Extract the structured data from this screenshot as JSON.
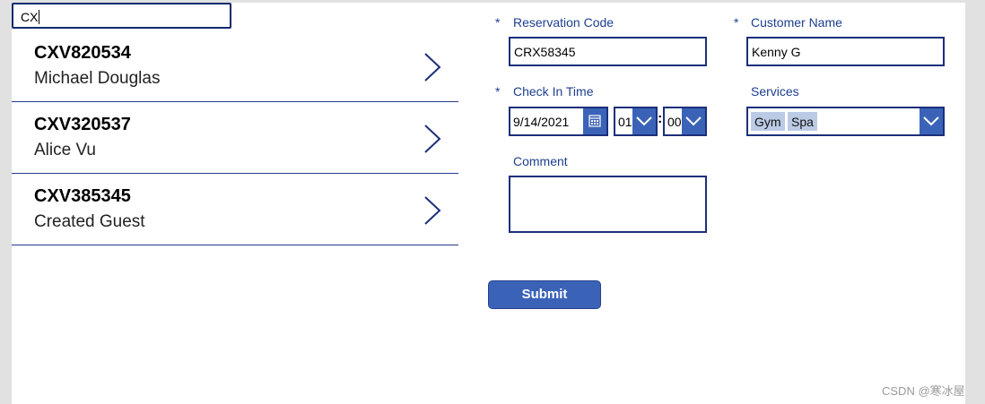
{
  "search": {
    "value": "CX"
  },
  "gallery": {
    "items": [
      {
        "code": "CXV820534",
        "name": "Michael Douglas"
      },
      {
        "code": "CXV320537",
        "name": "Alice Vu"
      },
      {
        "code": "CXV385345",
        "name": "Created Guest"
      }
    ]
  },
  "form": {
    "required_marker": "*",
    "reservation_code": {
      "label": "Reservation Code",
      "value": "CRX58345"
    },
    "customer_name": {
      "label": "Customer Name",
      "value": "Kenny G"
    },
    "check_in_time": {
      "label": "Check In Time",
      "date": "9/14/2021",
      "hour": "01",
      "minute": "00",
      "separator": ":"
    },
    "services": {
      "label": "Services",
      "selected": [
        "Gym",
        "Spa"
      ]
    },
    "comment": {
      "label": "Comment",
      "value": ""
    },
    "submit_label": "Submit"
  },
  "watermark": "CSDN @寒冰屋",
  "icons": {
    "gallery_chevron": "chevron-right-icon",
    "calendar": "calendar-icon",
    "dropdown": "chevron-down-icon"
  },
  "colors": {
    "accent": "#3a63b8",
    "border": "#1c2f7a",
    "label": "#1d3f8f",
    "tag": "#bccbe5"
  }
}
